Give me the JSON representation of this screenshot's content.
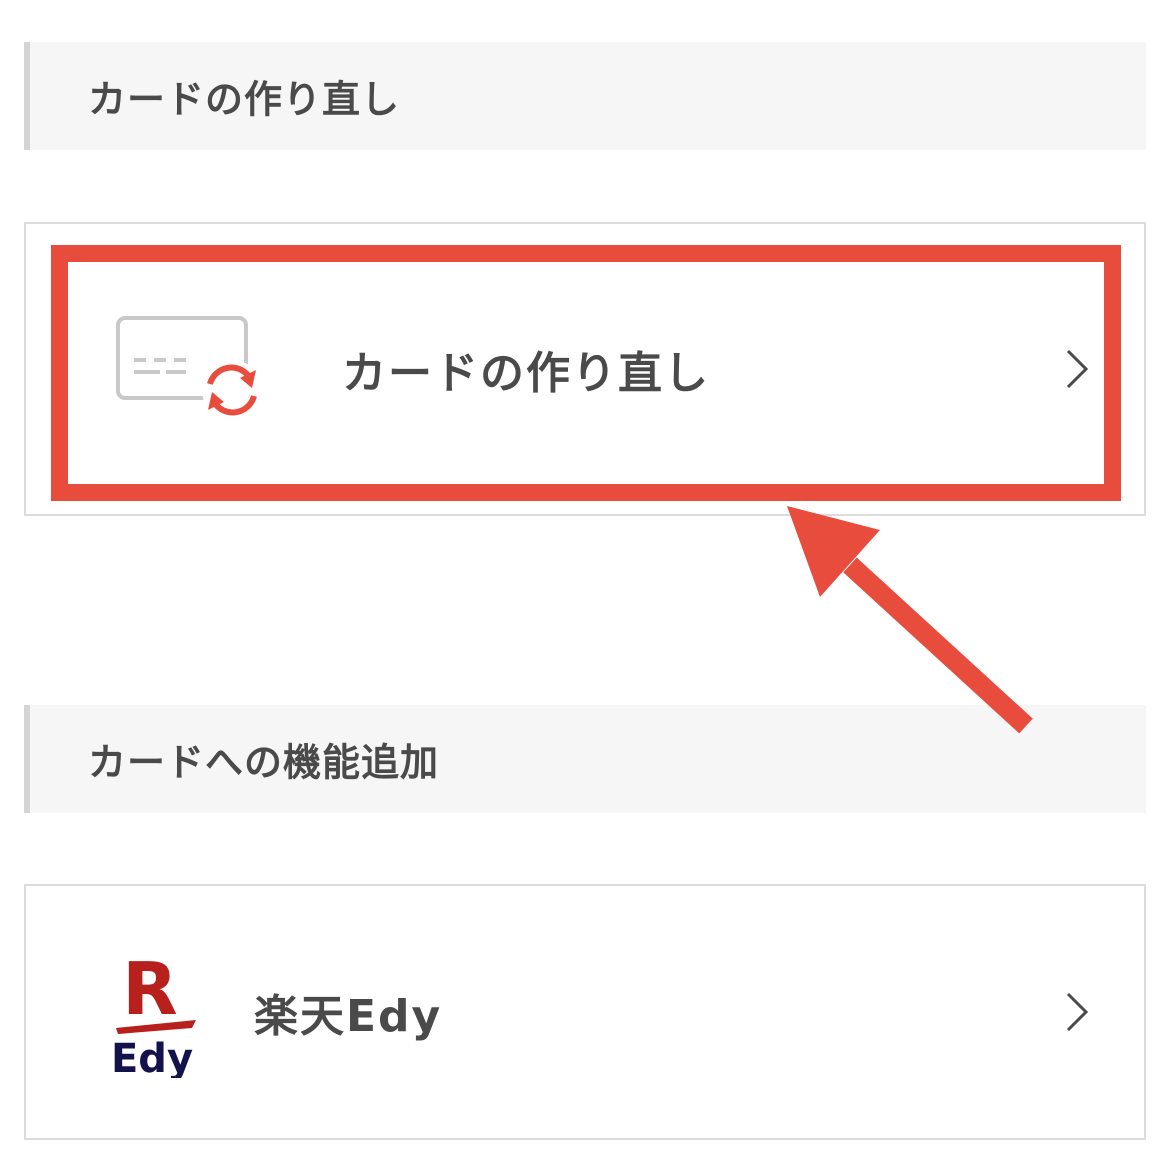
{
  "sections": [
    {
      "title": "カードの作り直し"
    },
    {
      "title": "カードへの機能追加"
    }
  ],
  "cards": [
    {
      "label": "カードの作り直し",
      "icon": "card-reissue-icon"
    },
    {
      "label": "楽天Edy",
      "icon": "rakuten-edy-logo",
      "logo_letter": "R",
      "logo_text": "Edy"
    }
  ],
  "colors": {
    "highlight": "#e84c3d",
    "text": "#4a4a4a",
    "header_bg": "#f6f6f6",
    "edy_red": "#b8201e",
    "edy_navy": "#13124a"
  }
}
